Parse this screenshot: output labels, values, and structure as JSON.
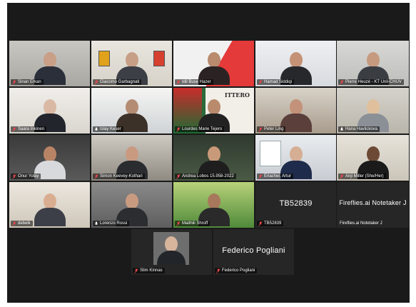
{
  "meeting": {
    "participants": [
      {
        "name": "Sinan Erkan",
        "muted": true
      },
      {
        "name": "Giacomo Garbagnati",
        "muted": true,
        "speaking": true
      },
      {
        "name": "Idil Buse Hazer",
        "muted": true
      },
      {
        "name": "Hamad Siddiqi",
        "muted": true
      },
      {
        "name": "Pierre Heuzé - KT Unil-CHUV",
        "muted": true
      },
      {
        "name": "Saara Inkinen",
        "muted": true
      },
      {
        "name": "Islay Keser",
        "muted": false
      },
      {
        "name": "Lourdes Marie Tejero",
        "muted": true,
        "background_text": "ITTERO"
      },
      {
        "name": "Peter Ling",
        "muted": true
      },
      {
        "name": "Hana Havlickova",
        "muted": false
      },
      {
        "name": "Onur Yolay",
        "muted": true
      },
      {
        "name": "Simon Keevey-Kothari",
        "muted": true
      },
      {
        "name": "Andrea Lobos 15.958-2022",
        "muted": true
      },
      {
        "name": "Erlacher, Artur",
        "muted": true
      },
      {
        "name": "Anji Miller (She/Her)",
        "muted": true
      },
      {
        "name": "debelk",
        "muted": true
      },
      {
        "name": "Lorenzo Rossi",
        "muted": false
      },
      {
        "name": "Maithili Shroff",
        "muted": true
      },
      {
        "name": "TB52839",
        "muted": true,
        "video_off": true,
        "display_name": "TB52839"
      },
      {
        "name": "Fireflies.ai Notetaker J",
        "muted": false,
        "video_off": true,
        "display_name": "Fireflies.ai Notetaker J"
      },
      {
        "name": "Slim Kinnas",
        "muted": true
      },
      {
        "name": "Federico Pogliani",
        "muted": true,
        "video_off": true,
        "display_name": "Federico Pogliani"
      }
    ]
  },
  "colors": {
    "background": "#1a1a1a",
    "tile": "#3b3b3b",
    "active_speaker_border": "#7cc44b",
    "mic_muted": "#e5484d",
    "label_text": "#ffffff"
  }
}
